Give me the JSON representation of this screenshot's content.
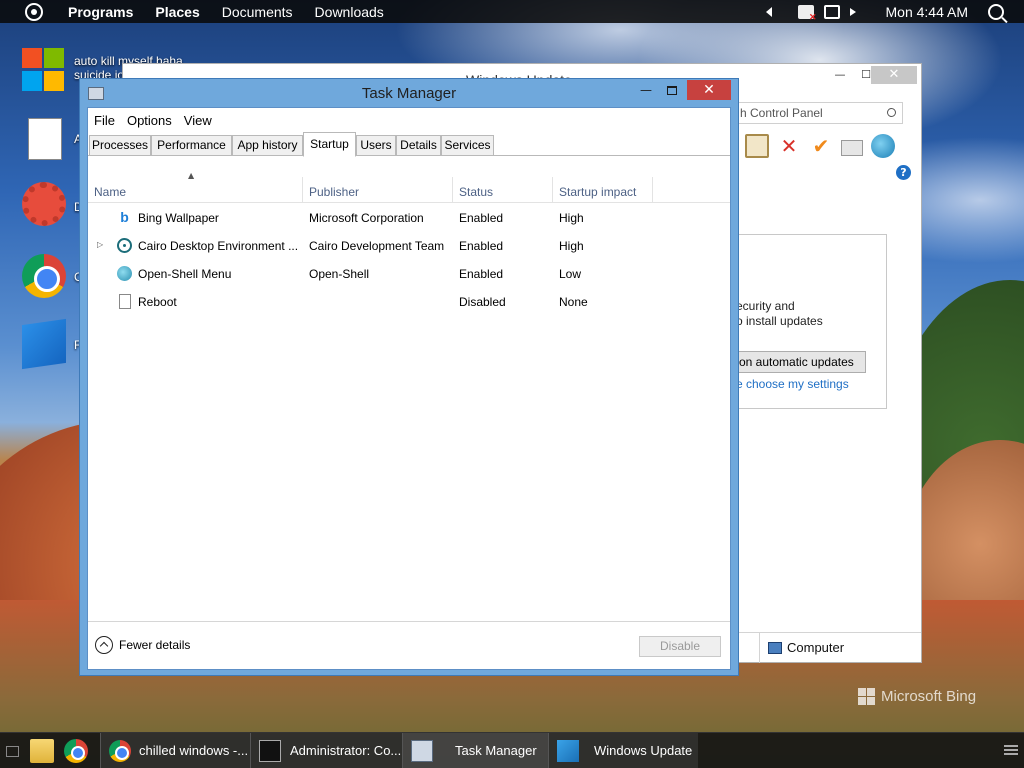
{
  "topbar": {
    "menu": [
      "Programs",
      "Places",
      "Documents",
      "Downloads"
    ],
    "clock": "Mon 4:44 AM"
  },
  "desktop": {
    "icons": [
      {
        "label": "auto kill myself haha suicide io",
        "icon": "windows-logo-icon"
      },
      {
        "label": "A",
        "icon": "document-icon"
      },
      {
        "label": "D",
        "icon": "gear-icon"
      },
      {
        "label": "C",
        "icon": "chrome-icon"
      },
      {
        "label": "F",
        "icon": "windows8-icon"
      }
    ],
    "watermark": "Microsoft Bing"
  },
  "windows_update": {
    "title": "Windows Update",
    "search_placeholder": "h Control Panel",
    "panel_text_1": "ecurity and",
    "panel_text_2": "o install updates",
    "button": "on automatic updates",
    "link": "e choose my settings",
    "status_computer": "Computer"
  },
  "task_manager": {
    "title": "Task Manager",
    "menu": [
      "File",
      "Options",
      "View"
    ],
    "tabs": [
      "Processes",
      "Performance",
      "App history",
      "Startup",
      "Users",
      "Details",
      "Services"
    ],
    "active_tab": "Startup",
    "columns": [
      "Name",
      "Publisher",
      "Status",
      "Startup impact"
    ],
    "rows": [
      {
        "name": "Bing Wallpaper",
        "publisher": "Microsoft Corporation",
        "status": "Enabled",
        "impact": "High",
        "icon": "bing-icon",
        "expandable": false
      },
      {
        "name": "Cairo Desktop Environment ...",
        "publisher": "Cairo Development Team",
        "status": "Enabled",
        "impact": "High",
        "icon": "cairo-icon",
        "expandable": true
      },
      {
        "name": "Open-Shell Menu",
        "publisher": "Open-Shell",
        "status": "Enabled",
        "impact": "Low",
        "icon": "open-shell-icon",
        "expandable": false
      },
      {
        "name": "Reboot",
        "publisher": "",
        "status": "Disabled",
        "impact": "None",
        "icon": "file-icon",
        "expandable": false
      }
    ],
    "fewer_details": "Fewer details",
    "disable_button": "Disable"
  },
  "taskbar": {
    "tasks": [
      {
        "label": "chilled windows -...",
        "icon": "chrome-icon"
      },
      {
        "label": "Administrator: Co...",
        "icon": "cmd-icon"
      },
      {
        "label": "Task Manager",
        "icon": "task-manager-icon"
      },
      {
        "label": "Windows Update",
        "icon": "windows-update-icon"
      }
    ]
  }
}
